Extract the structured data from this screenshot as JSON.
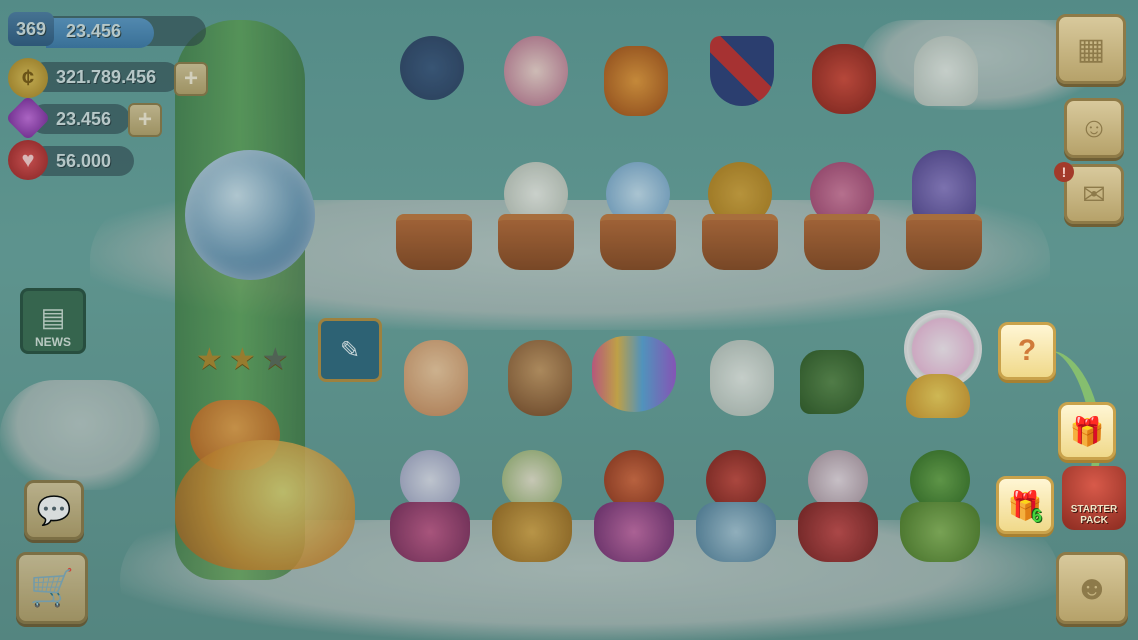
{
  "hud": {
    "level": "369",
    "xp": "23.456",
    "xp_progress": 0.72,
    "coins": "321.789.456",
    "gems": "23.456",
    "hearts": "56.000"
  },
  "left_panel": {
    "news_label": "NEWS",
    "stars_filled": 2,
    "stars_total": 3
  },
  "right_panel": {
    "help_glyph": "?",
    "mail_alert": "!",
    "gift_count": "6",
    "starter_pack_label": "STARTER PACK"
  },
  "icons": {
    "level": "level-shield-icon",
    "coin": "coin-icon",
    "gem": "gem-icon",
    "heart": "heart-icon",
    "plus": "plus-icon",
    "news": "newspaper-icon",
    "chat": "chat-bubble-icon",
    "shop": "shopping-cart-icon",
    "grid": "grid-collection-icon",
    "profile": "profile-icon",
    "mail": "envelope-icon",
    "help": "question-mark-icon",
    "gift_box": "gift-box-icon",
    "friends": "friends-icon"
  },
  "colors": {
    "background": "#5f9d98",
    "button_face": "#d8c99c",
    "button_bright": "#fff6d4",
    "pot": "#b96a36",
    "count_green": "#45d43c"
  }
}
